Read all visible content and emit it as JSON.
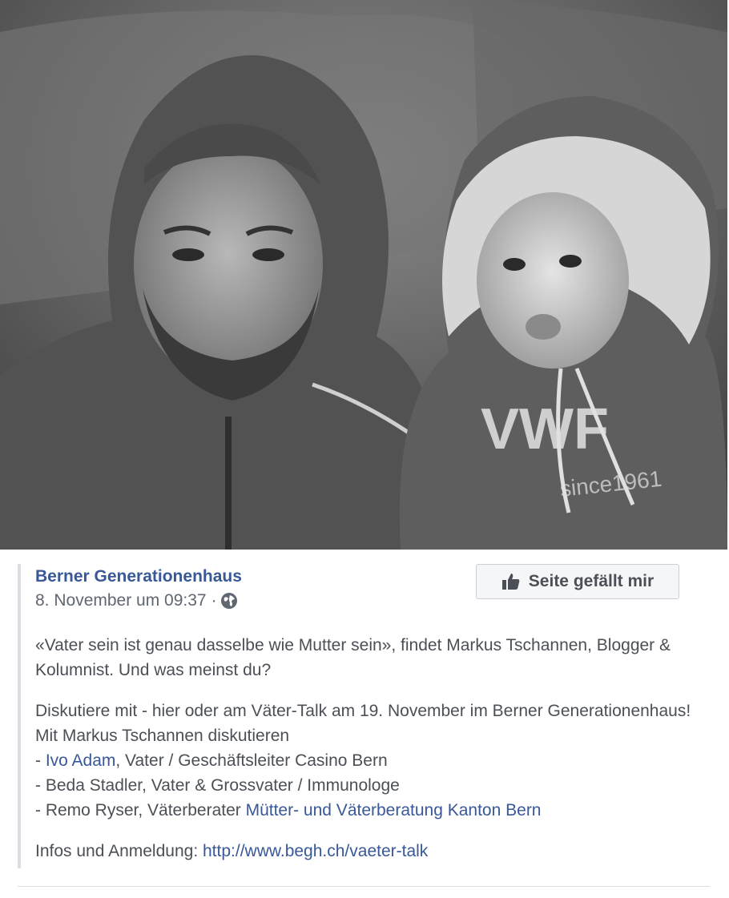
{
  "post": {
    "page_name": "Berner Generationenhaus",
    "timestamp": "8. November um 09:37",
    "separator": "·",
    "like_button_label": "Seite gefällt mir",
    "photo_print_text": "since1961",
    "photo_logo_text": "VWF",
    "paragraph1": "«Vater sein ist genau dasselbe wie Mutter sein», findet Markus Tschannen, Blogger & Kolumnist. Und was meinst du?",
    "paragraph2_intro": "Diskutiere mit - hier oder am Väter-Talk am 19. November im Berner Generationenhaus! Mit Markus Tschannen diskutieren",
    "speaker1_prefix": "- ",
    "speaker1_link": "Ivo Adam",
    "speaker1_rest": ", Vater / Geschäftsleiter Casino Bern",
    "speaker2": "- Beda Stadler, Vater & Grossvater / Immunologe",
    "speaker3_prefix": "- Remo Ryser, Väterberater ",
    "speaker3_link": "Mütter- und Väterberatung Kanton Bern",
    "info_label": "Infos und Anmeldung: ",
    "info_link": "http://www.begh.ch/vaeter-talk"
  },
  "colors": {
    "link": "#385898",
    "body_text": "#4b4f56",
    "meta_text": "#606770"
  }
}
